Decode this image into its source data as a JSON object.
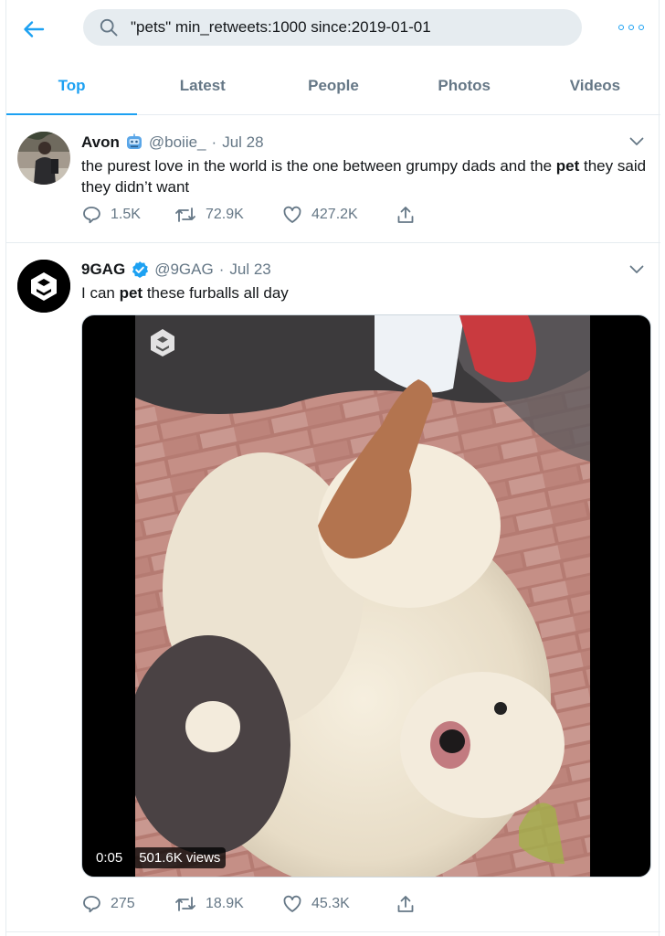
{
  "search": {
    "query": "\"pets\" min_retweets:1000 since:2019-01-01"
  },
  "tabs": [
    {
      "label": "Top"
    },
    {
      "label": "Latest"
    },
    {
      "label": "People"
    },
    {
      "label": "Photos"
    },
    {
      "label": "Videos"
    }
  ],
  "tweets": [
    {
      "name": "Avon",
      "badge": "robot-emoji",
      "handle": "@boiie_",
      "dot": "·",
      "date": "Jul 28",
      "text_before": "the purest love in the world is the one between grumpy dads and the ",
      "highlight": "pet",
      "text_after": " they said they didn’t want",
      "replies": "1.5K",
      "retweets": "72.9K",
      "likes": "427.2K"
    },
    {
      "name": "9GAG",
      "badge": "verified-badge",
      "handle": "@9GAG",
      "dot": "·",
      "date": "Jul 23",
      "text_before": "I can ",
      "highlight": "pet",
      "text_after": " these furballs all day",
      "video_time": "0:05",
      "video_views": "501.6K views",
      "replies": "275",
      "retweets": "18.9K",
      "likes": "45.3K"
    }
  ],
  "colors": {
    "accent": "#1da1f2",
    "muted": "#657786",
    "divider": "#e6ecf0"
  }
}
